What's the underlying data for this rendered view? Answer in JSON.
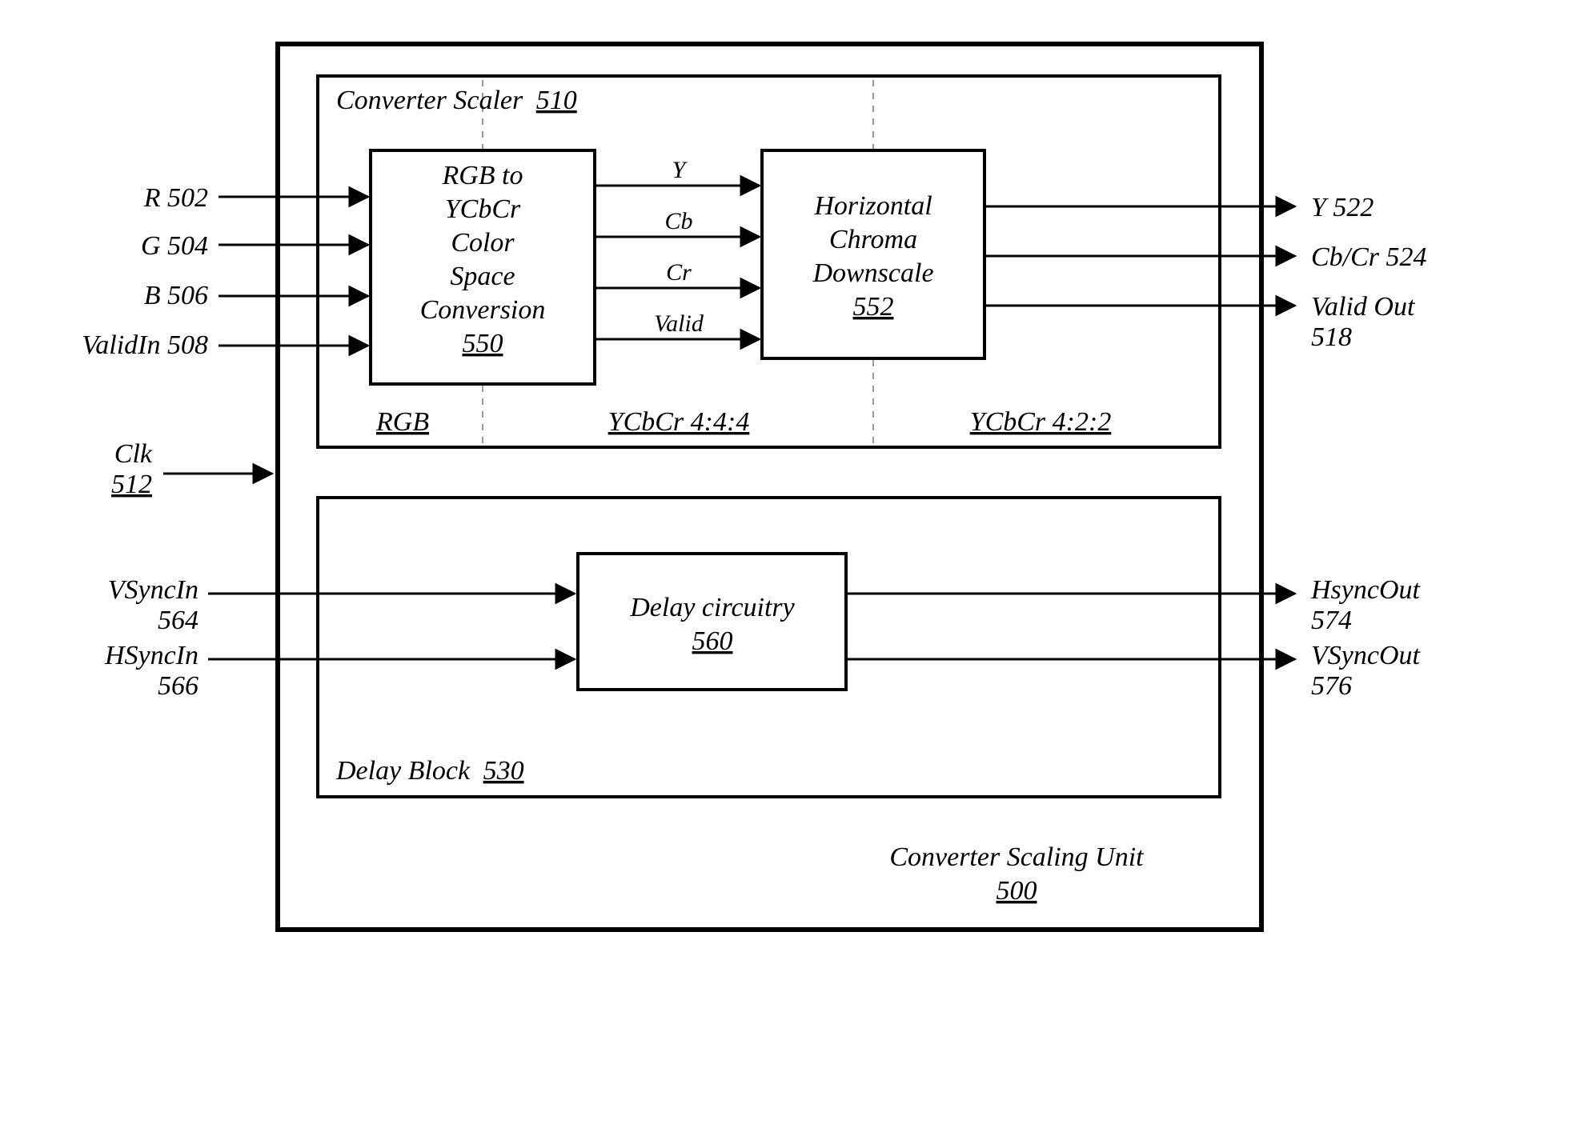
{
  "inputs": {
    "r": "R 502",
    "g": "G 504",
    "b": "B 506",
    "validin": "ValidIn 508",
    "clk_l1": "Clk",
    "clk_l2": "512",
    "vsync_l1": "VSyncIn",
    "vsync_l2": "564",
    "hsync_l1": "HSyncIn",
    "hsync_l2": "566"
  },
  "outputs": {
    "y": "Y 522",
    "cbcr": "Cb/Cr 524",
    "valid_l1": "Valid Out",
    "valid_l2": "518",
    "hs_l1": "HsyncOut",
    "hs_l2": "574",
    "vs_l1": "VSyncOut",
    "vs_l2": "576"
  },
  "scaler": {
    "title_text": "Converter Scaler",
    "title_num": "510",
    "rgb_block": {
      "l1": "RGB to",
      "l2": "YCbCr",
      "l3": "Color",
      "l4": "Space",
      "l5": "Conversion",
      "num": "550"
    },
    "down_block": {
      "l1": "Horizontal",
      "l2": "Chroma",
      "l3": "Downscale",
      "num": "552"
    },
    "mid_signals": {
      "y": "Y",
      "cb": "Cb",
      "cr": "Cr",
      "valid": "Valid"
    },
    "stages": {
      "s1": "RGB",
      "s2": "YCbCr 4:4:4",
      "s3": "YCbCr 4:2:2"
    }
  },
  "delay": {
    "title_text": "Delay Block",
    "title_num": "530",
    "block_text": "Delay circuitry",
    "block_num": "560"
  },
  "unit": {
    "title": "Converter Scaling Unit",
    "num": "500"
  }
}
